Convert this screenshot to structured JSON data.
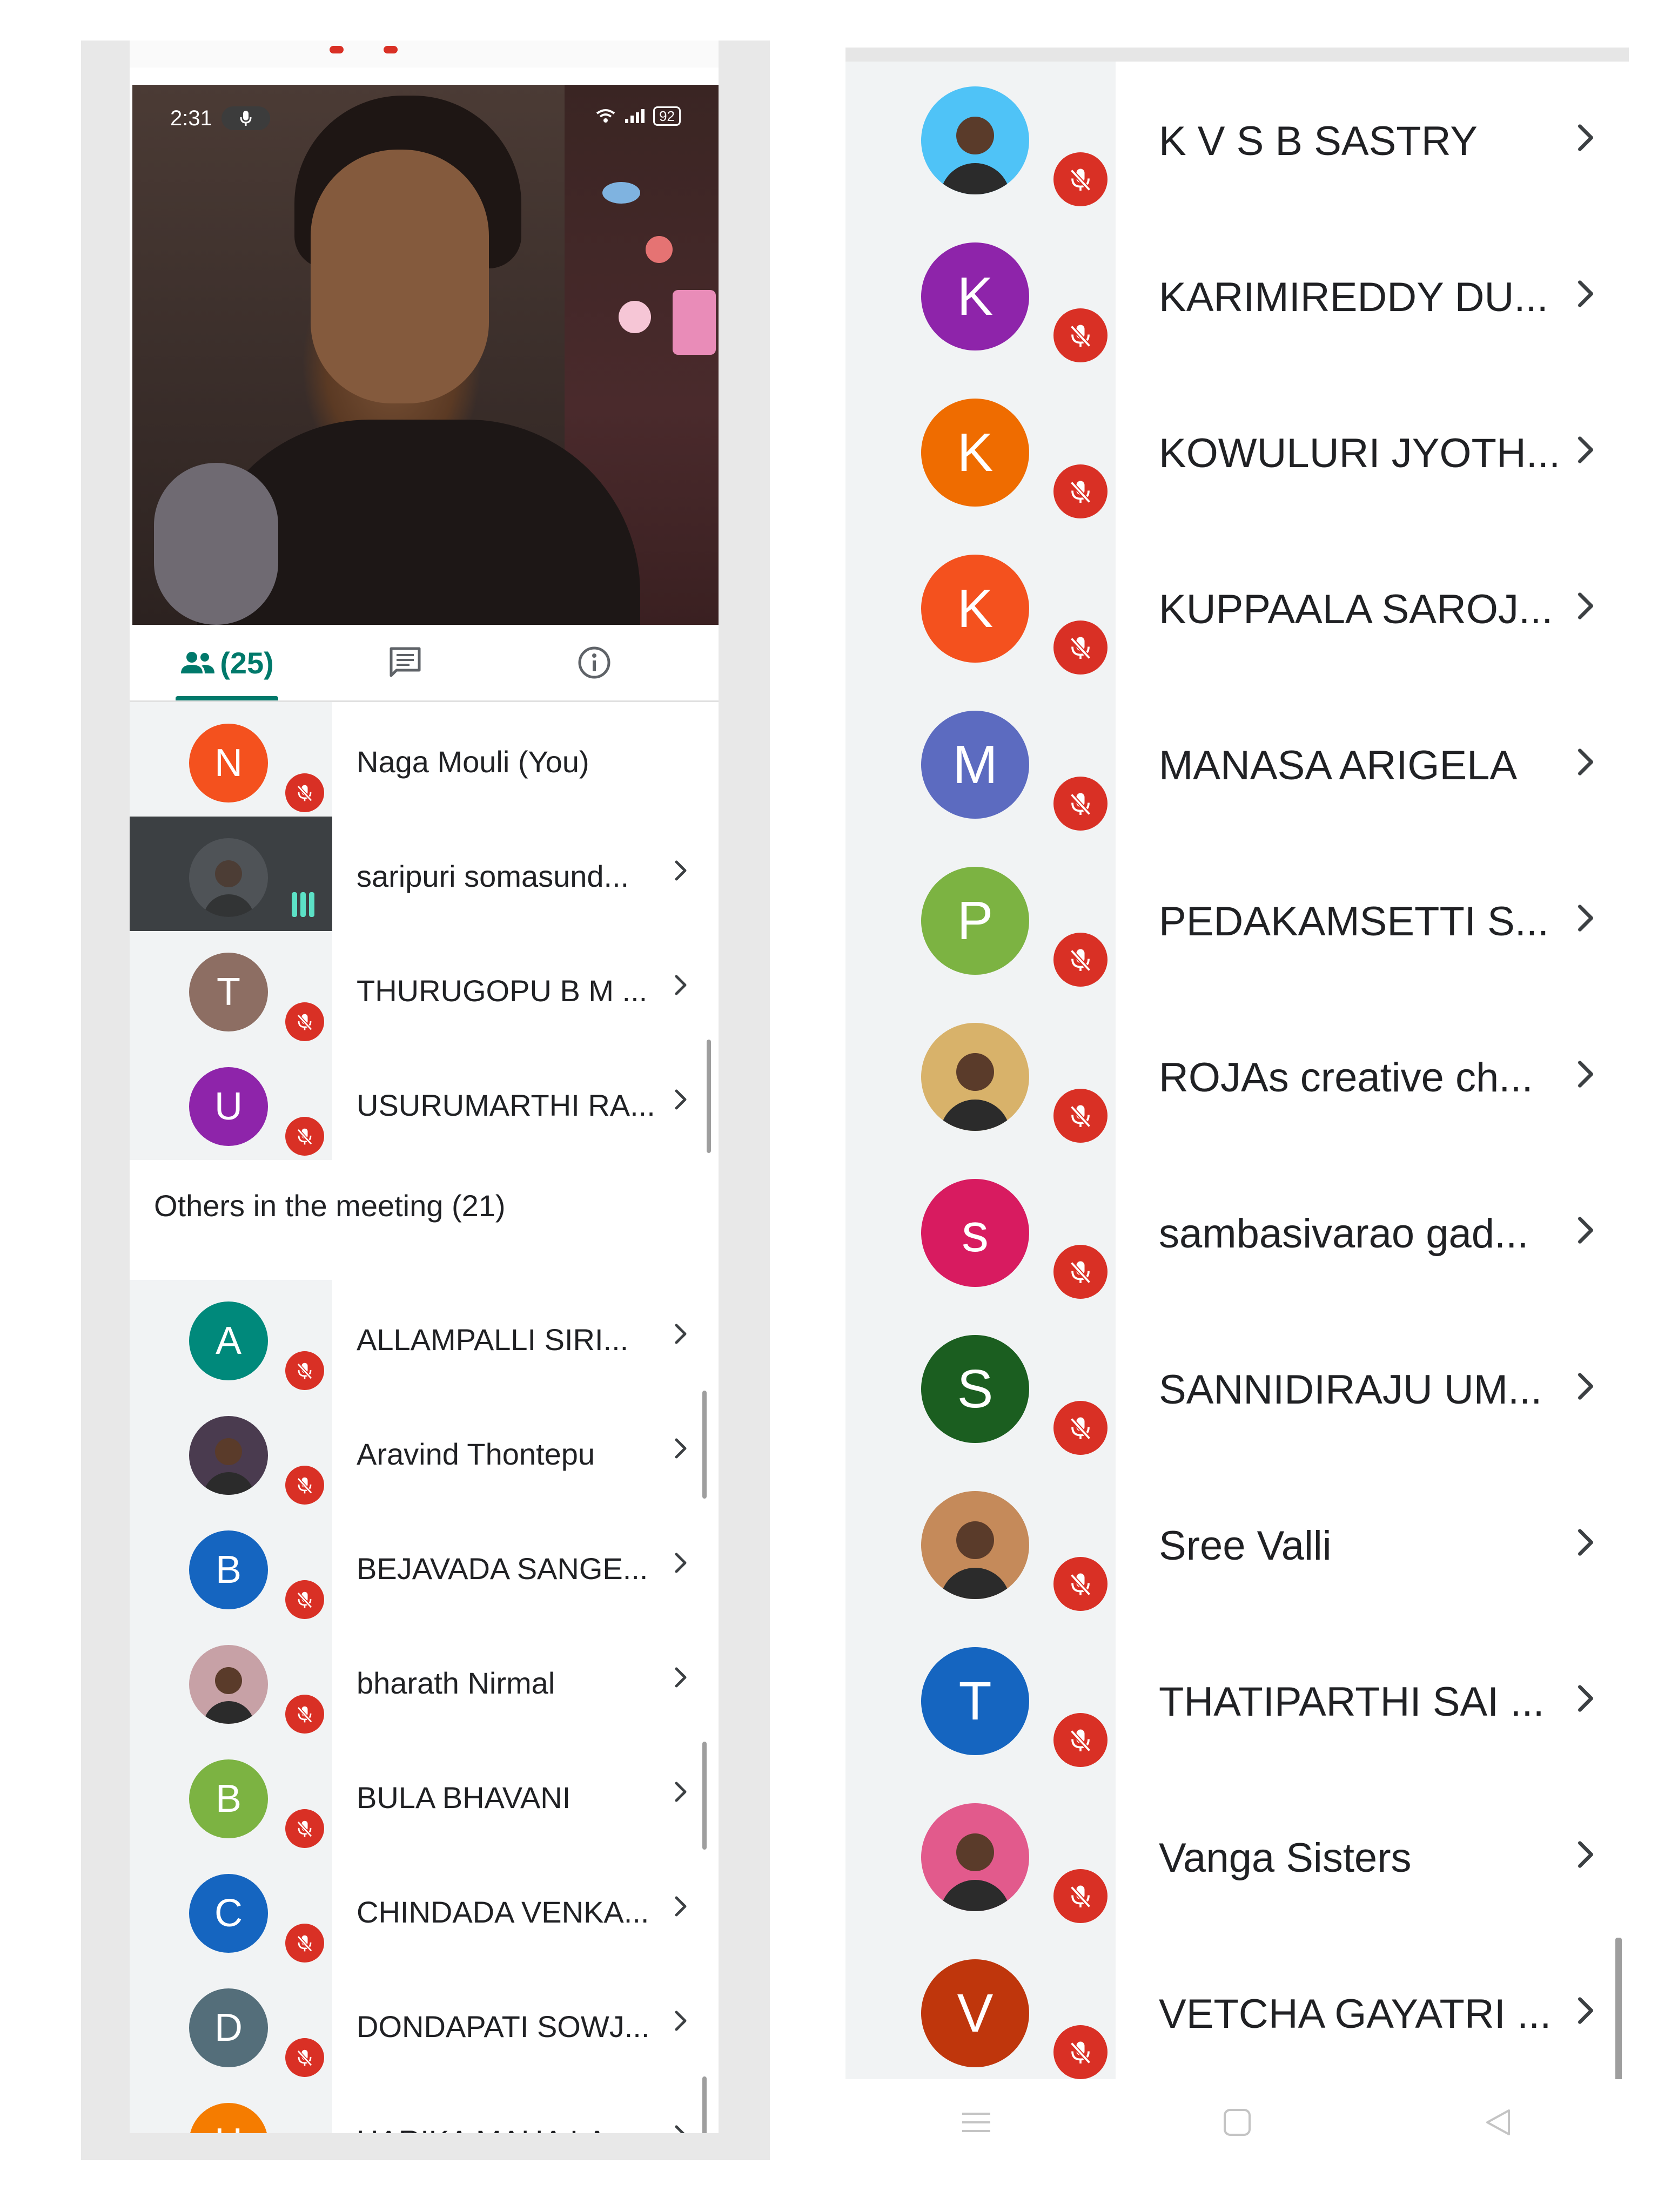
{
  "status_bar": {
    "time": "2:31",
    "battery": "92"
  },
  "tabs": {
    "people_count": "(25)"
  },
  "participants": [
    {
      "initial": "N",
      "name": "Naga Mouli (You)",
      "color": "#f4511e",
      "muted": true,
      "chevron": false,
      "type": "letter"
    },
    {
      "initial": "",
      "name": "saripuri somasund...",
      "color": "#5f6368",
      "muted": false,
      "chevron": true,
      "type": "photo-speaking"
    },
    {
      "initial": "T",
      "name": "THURUGOPU B M ...",
      "color": "#8d6e63",
      "muted": true,
      "chevron": true,
      "type": "letter"
    },
    {
      "initial": "U",
      "name": "USURUMARTHI RA...",
      "color": "#8e24aa",
      "muted": true,
      "chevron": true,
      "type": "letter"
    }
  ],
  "others_header": "Others in the meeting (21)",
  "others_left": [
    {
      "initial": "A",
      "name": "ALLAMPALLI SIRI...",
      "color": "#00897b",
      "type": "letter"
    },
    {
      "initial": "",
      "name": "Aravind Thontepu",
      "color": "#4a3b4f",
      "type": "photo"
    },
    {
      "initial": "B",
      "name": "BEJAVADA SANGE...",
      "color": "#1565c0",
      "type": "letter"
    },
    {
      "initial": "",
      "name": "bharath Nirmal",
      "color": "#c7a1a6",
      "type": "photo"
    },
    {
      "initial": "B",
      "name": "BULA BHAVANI",
      "color": "#7cb342",
      "type": "letter"
    },
    {
      "initial": "C",
      "name": "CHINDADA VENKA...",
      "color": "#1565c0",
      "type": "letter"
    },
    {
      "initial": "D",
      "name": "DONDAPATI SOWJ...",
      "color": "#546e7a",
      "type": "letter"
    },
    {
      "initial": "H",
      "name": "HARIKA MAHA LA...",
      "color": "#f57c00",
      "type": "letter"
    }
  ],
  "others_right": [
    {
      "initial": "",
      "name": "K V S B SASTRY",
      "color": "#4fc3f7",
      "type": "photo"
    },
    {
      "initial": "K",
      "name": "KARIMIREDDY DU...",
      "color": "#8e24aa",
      "type": "letter"
    },
    {
      "initial": "K",
      "name": "KOWULURI JYOTH...",
      "color": "#ef6c00",
      "type": "letter"
    },
    {
      "initial": "K",
      "name": "KUPPAALA SAROJ...",
      "color": "#f4511e",
      "type": "letter"
    },
    {
      "initial": "M",
      "name": "MANASA ARIGELA",
      "color": "#5c6bc0",
      "type": "letter"
    },
    {
      "initial": "P",
      "name": "PEDAKAMSETTI S...",
      "color": "#7cb342",
      "type": "letter"
    },
    {
      "initial": "",
      "name": "ROJAs creative ch...",
      "color": "#d8b26a",
      "type": "photo"
    },
    {
      "initial": "s",
      "name": "sambasivarao gad...",
      "color": "#d81b60",
      "type": "letter"
    },
    {
      "initial": "S",
      "name": "SANNIDIRAJU UM...",
      "color": "#1b5e20",
      "type": "letter"
    },
    {
      "initial": "",
      "name": "Sree Valli",
      "color": "#c58a5a",
      "type": "photo"
    },
    {
      "initial": "T",
      "name": "THATIPARTHI SAI ...",
      "color": "#1565c0",
      "type": "letter"
    },
    {
      "initial": "",
      "name": "Vanga Sisters",
      "color": "#e25a8c",
      "type": "photo"
    },
    {
      "initial": "V",
      "name": "VETCHA GAYATRI ...",
      "color": "#bf360c",
      "type": "letter"
    }
  ],
  "icons": {
    "mute": "mic-off-icon",
    "chevron": "chevron-right-icon",
    "people": "people-icon",
    "chat": "chat-icon",
    "info": "info-icon",
    "speaking": "speaking-bars-icon"
  }
}
